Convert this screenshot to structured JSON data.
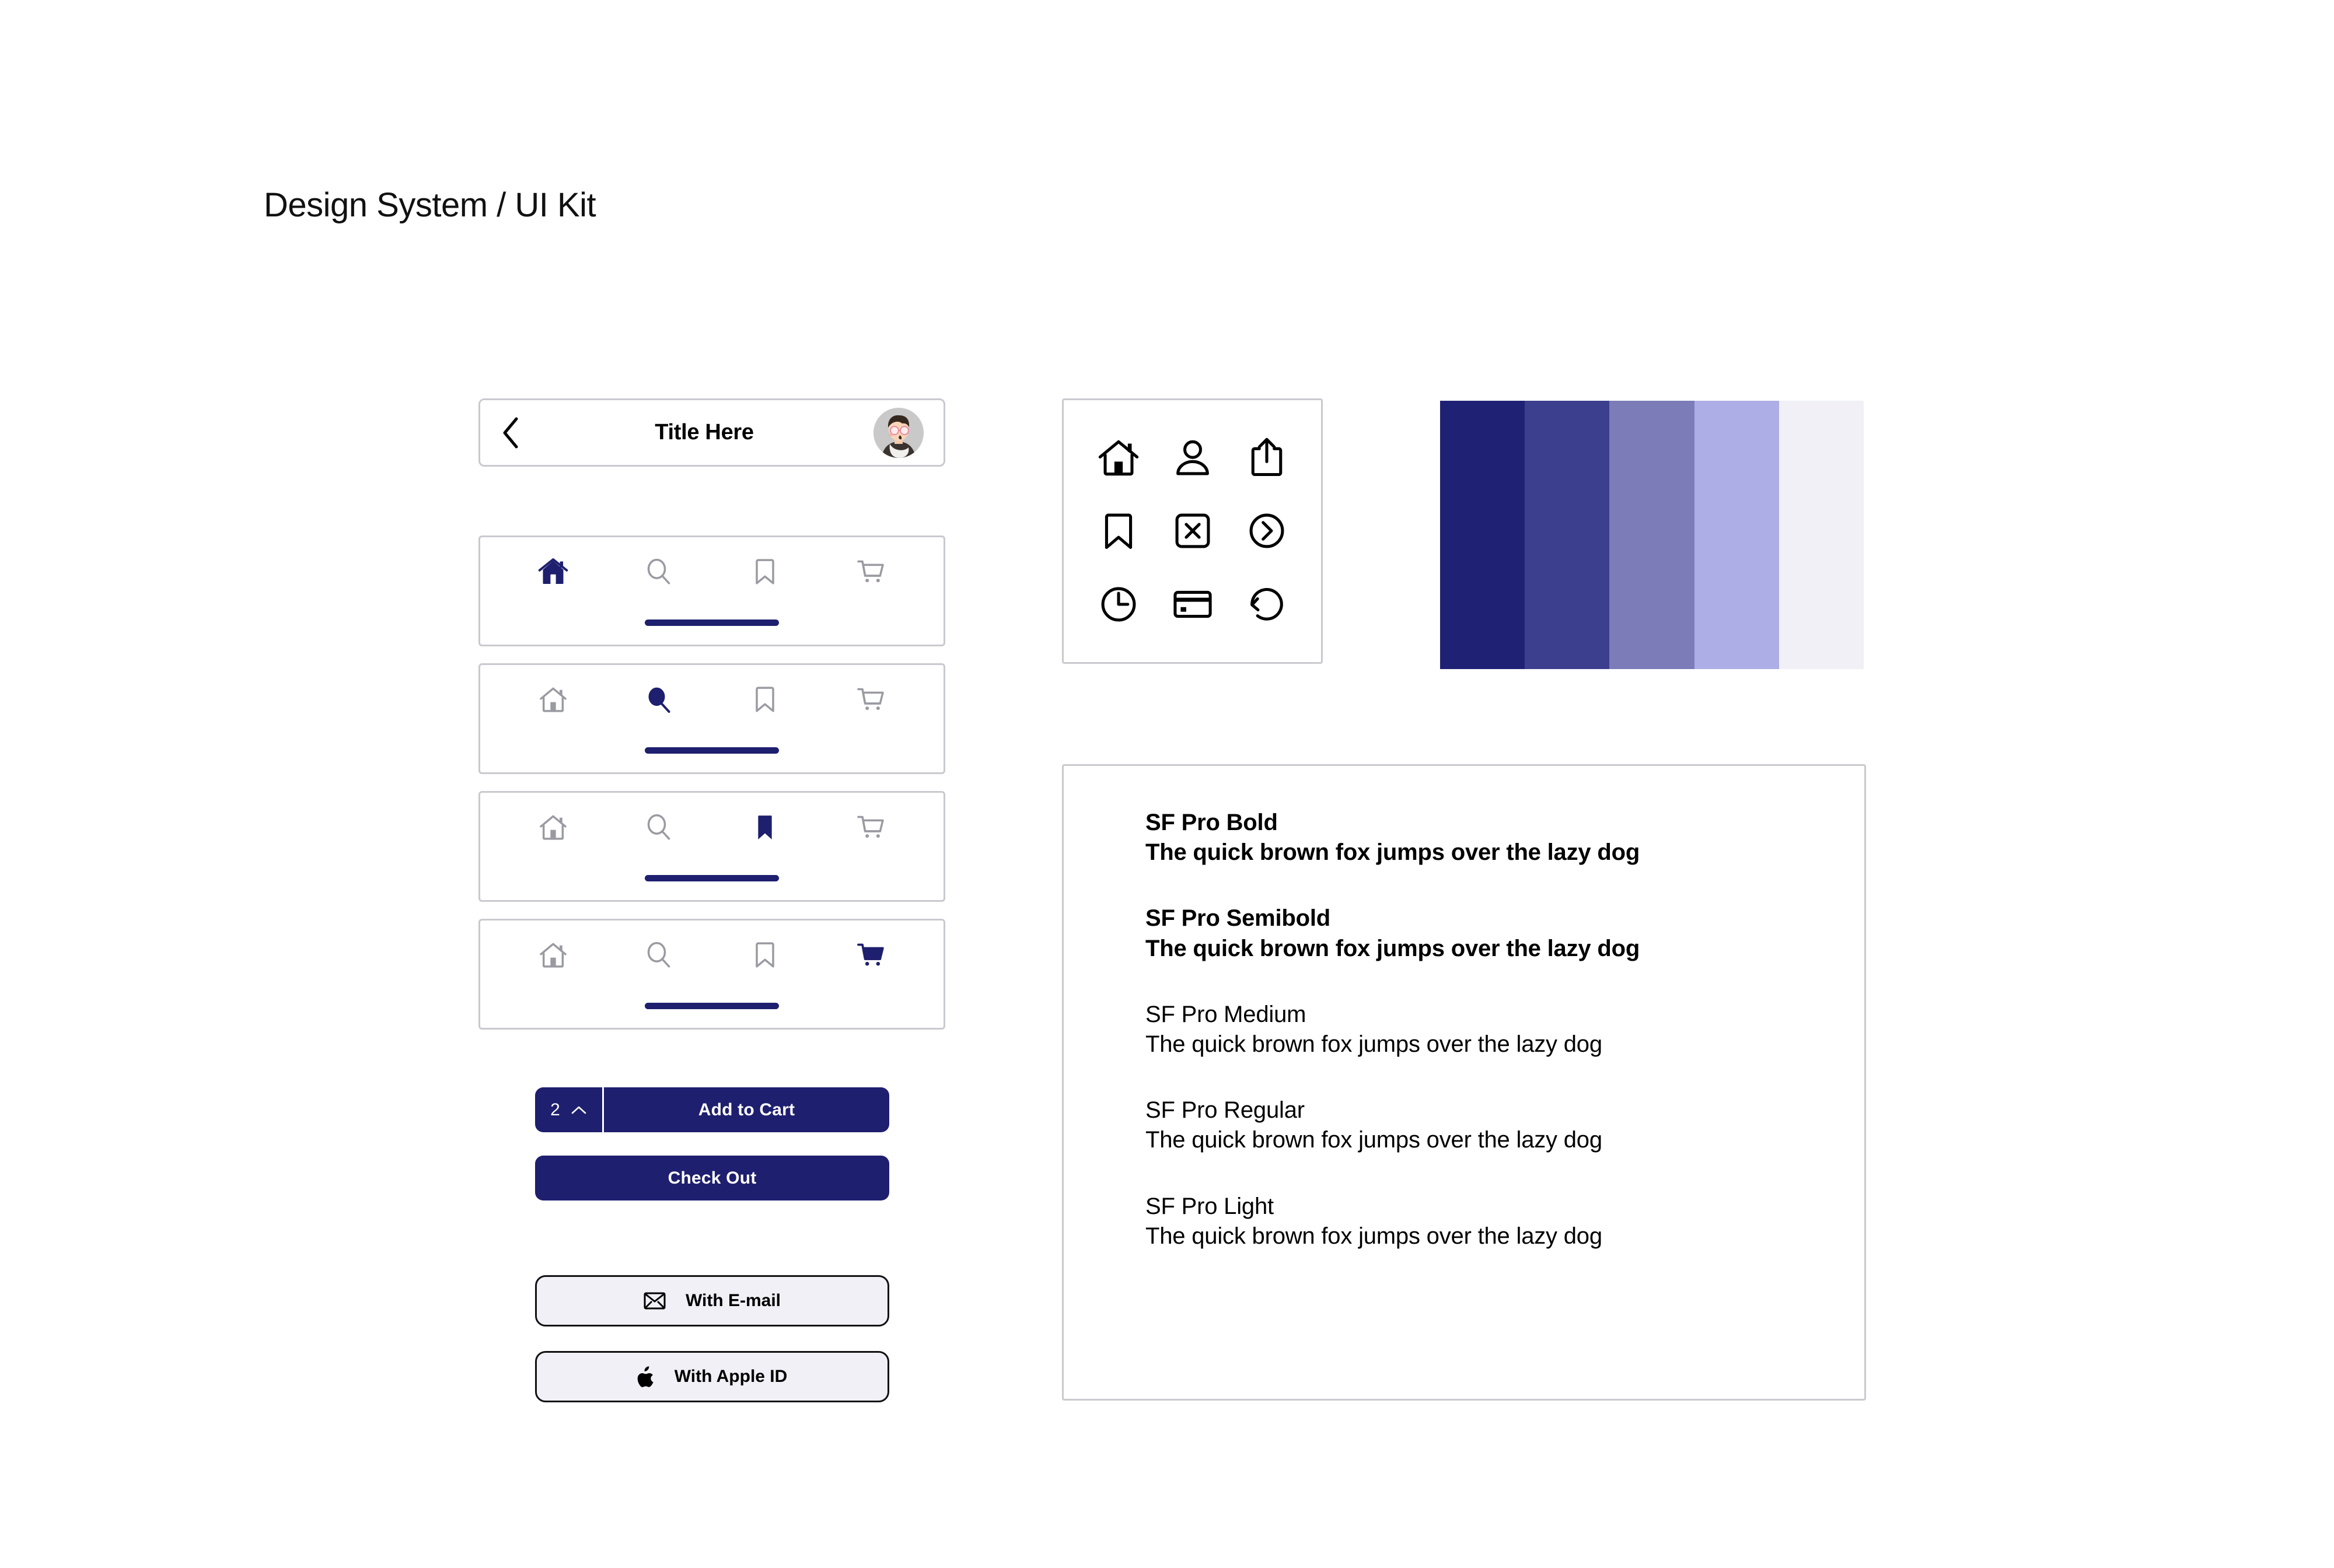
{
  "page": {
    "title": "Design System / UI Kit",
    "background": "#ffffff"
  },
  "colors": {
    "navy": "#1e1f6e",
    "border_gray": "#c9c9cf",
    "icon_inactive": "#9a9aa2",
    "surface_light": "#f0f0f6"
  },
  "navbar": {
    "back_icon": "chevron-left-icon",
    "title": "Title Here",
    "avatar_icon": "user-avatar"
  },
  "tabbars": [
    {
      "active": "home",
      "items": [
        {
          "name": "home",
          "label": "Home",
          "icon": "home-icon",
          "active": true
        },
        {
          "name": "search",
          "label": "Search",
          "icon": "search-icon",
          "active": false
        },
        {
          "name": "bookmark",
          "label": "Bookmark",
          "icon": "bookmark-icon",
          "active": false
        },
        {
          "name": "cart",
          "label": "Cart",
          "icon": "cart-icon",
          "active": false
        }
      ]
    },
    {
      "active": "search",
      "items": [
        {
          "name": "home",
          "label": "Home",
          "icon": "home-icon",
          "active": false
        },
        {
          "name": "search",
          "label": "Search",
          "icon": "search-icon",
          "active": true
        },
        {
          "name": "bookmark",
          "label": "Bookmark",
          "icon": "bookmark-icon",
          "active": false
        },
        {
          "name": "cart",
          "label": "Cart",
          "icon": "cart-icon",
          "active": false
        }
      ]
    },
    {
      "active": "bookmark",
      "items": [
        {
          "name": "home",
          "label": "Home",
          "icon": "home-icon",
          "active": false
        },
        {
          "name": "search",
          "label": "Search",
          "icon": "search-icon",
          "active": false
        },
        {
          "name": "bookmark",
          "label": "Bookmark",
          "icon": "bookmark-icon",
          "active": true
        },
        {
          "name": "cart",
          "label": "Cart",
          "icon": "cart-icon",
          "active": false
        }
      ]
    },
    {
      "active": "cart",
      "items": [
        {
          "name": "home",
          "label": "Home",
          "icon": "home-icon",
          "active": false
        },
        {
          "name": "search",
          "label": "Search",
          "icon": "search-icon",
          "active": false
        },
        {
          "name": "bookmark",
          "label": "Bookmark",
          "icon": "bookmark-icon",
          "active": false
        },
        {
          "name": "cart",
          "label": "Cart",
          "icon": "cart-icon",
          "active": true
        }
      ]
    }
  ],
  "buttons": {
    "quantity_value": "2",
    "quantity_chevron_icon": "chevron-up-icon",
    "add_to_cart_label": "Add to Cart",
    "check_out_label": "Check Out",
    "email_label": "With E-mail",
    "email_icon": "envelope-icon",
    "apple_label": "With Apple ID",
    "apple_icon": "apple-logo-icon"
  },
  "icon_grid": [
    {
      "name": "home-icon",
      "label": "Home"
    },
    {
      "name": "person-icon",
      "label": "Person"
    },
    {
      "name": "share-icon",
      "label": "Share"
    },
    {
      "name": "bookmark-icon",
      "label": "Bookmark"
    },
    {
      "name": "close-box-icon",
      "label": "Close"
    },
    {
      "name": "chevron-right-circle-icon",
      "label": "Next"
    },
    {
      "name": "clock-icon",
      "label": "Clock"
    },
    {
      "name": "credit-card-icon",
      "label": "Credit Card"
    },
    {
      "name": "refresh-icon",
      "label": "Refresh"
    }
  ],
  "palette": [
    {
      "name": "navy-900",
      "hex": "#1f2175"
    },
    {
      "name": "navy-700",
      "hex": "#3c3f8d"
    },
    {
      "name": "indigo-400",
      "hex": "#7b7cb8"
    },
    {
      "name": "indigo-200",
      "hex": "#aeaee6"
    },
    {
      "name": "indigo-50",
      "hex": "#f0f0f6"
    }
  ],
  "typography": {
    "sample": "The quick brown fox jumps over the lazy dog",
    "weights": [
      {
        "name": "SF Pro Bold",
        "sample": "The quick brown fox jumps over the lazy dog"
      },
      {
        "name": "SF Pro Semibold",
        "sample": "The quick brown fox jumps over the lazy dog"
      },
      {
        "name": "SF Pro Medium",
        "sample": "The quick brown fox jumps over the lazy dog"
      },
      {
        "name": "SF Pro Regular",
        "sample": "The quick brown fox jumps over the lazy dog"
      },
      {
        "name": "SF Pro Light",
        "sample": "The quick brown fox jumps over the lazy dog"
      }
    ]
  }
}
